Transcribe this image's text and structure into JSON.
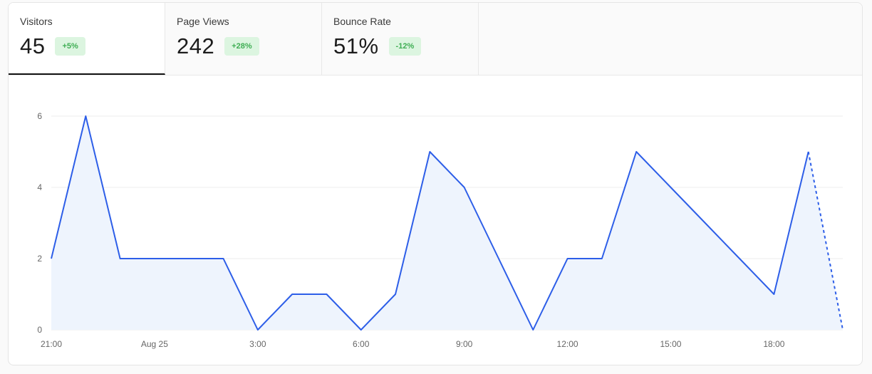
{
  "tabs": [
    {
      "label": "Visitors",
      "value": "45",
      "change": "+5%",
      "active": true
    },
    {
      "label": "Page Views",
      "value": "242",
      "change": "+28%",
      "active": false
    },
    {
      "label": "Bounce Rate",
      "value": "51%",
      "change": "-12%",
      "active": false
    }
  ],
  "colors": {
    "line": "#2d5ee8",
    "area": "#eef4fd",
    "grid": "#ececec",
    "badge_bg": "#dcf5e0",
    "badge_text": "#3fae54"
  },
  "chart_data": {
    "type": "area",
    "title": "",
    "xlabel": "",
    "ylabel": "",
    "ylim": [
      0,
      6
    ],
    "y_ticks": [
      "0",
      "2",
      "4",
      "6"
    ],
    "x_tick_labels": [
      "21:00",
      "Aug 25",
      "3:00",
      "6:00",
      "9:00",
      "12:00",
      "15:00",
      "18:00"
    ],
    "x": [
      "21:00",
      "22:00",
      "23:00",
      "00:00",
      "01:00",
      "02:00",
      "03:00",
      "04:00",
      "05:00",
      "06:00",
      "07:00",
      "08:00",
      "09:00",
      "10:00",
      "11:00",
      "12:00",
      "13:00",
      "14:00",
      "15:00",
      "16:00",
      "17:00",
      "18:00",
      "19:00",
      "20:00"
    ],
    "series": [
      {
        "values": [
          2,
          6,
          2,
          2,
          2,
          2,
          0,
          1,
          1,
          0,
          1,
          5,
          4,
          2,
          0,
          2,
          2,
          5,
          4,
          3,
          2,
          1,
          5,
          0
        ]
      }
    ],
    "incomplete_last_segment": true,
    "grid": true
  }
}
